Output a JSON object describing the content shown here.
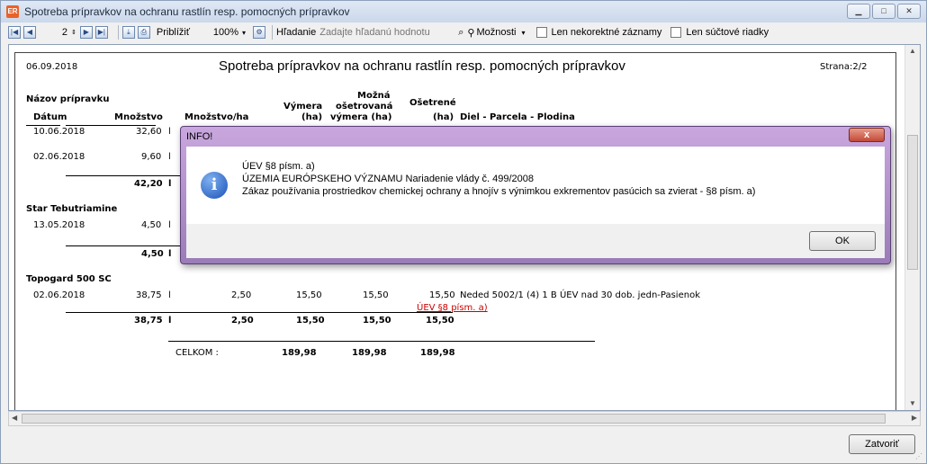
{
  "window": {
    "title": "Spotreba prípravkov na ochranu rastlín resp. pomocných prípravkov"
  },
  "toolbar": {
    "page_number": "2",
    "zoom_label": "Priblížiť",
    "zoom_value": "100%",
    "search_label": "Hľadanie",
    "search_placeholder": "Zadajte hľadanú hodnotu",
    "options_label": "Možnosti",
    "incorrect_only_label": "Len nekorektné záznamy",
    "sum_rows_label": "Len súčtové riadky"
  },
  "report": {
    "date": "06.09.2018",
    "title": "Spotreba prípravkov na ochranu rastlín resp. pomocných prípravkov",
    "page_label": "Strana:2/2",
    "headers": {
      "product_name": "Názov prípravku",
      "date": "Dátum",
      "quantity": "Množstvo",
      "quantity_per_ha": "Množstvo/ha",
      "area_line1": "Výmera",
      "area_line2": "(ha)",
      "possible_line1": "Možná",
      "possible_line2": "ošetrovaná",
      "possible_line3": "výmera (ha)",
      "treated_line1": "Ošetrené",
      "treated_line2": "(ha)",
      "location": "Diel - Parcela - Plodina"
    },
    "group1": {
      "rows": [
        {
          "date": "10.06.2018",
          "quantity": "32,60",
          "unit": "l"
        },
        {
          "date": "02.06.2018",
          "quantity": "9,60",
          "unit": "l"
        }
      ],
      "total_quantity": "42,20",
      "total_unit": "l"
    },
    "group2": {
      "name": "Star Tebutriamine",
      "rows": [
        {
          "date": "13.05.2018",
          "quantity": "4,50",
          "unit": "l"
        }
      ],
      "total_quantity": "4,50",
      "total_unit": "l"
    },
    "group3": {
      "name": "Topogard 500 SC",
      "row": {
        "date": "02.06.2018",
        "quantity": "38,75",
        "unit": "l",
        "qty_per_ha": "2,50",
        "area": "15,50",
        "possible": "15,50",
        "treated": "15,50",
        "location": "Neded 5002/1 (4) 1 B ÚEV nad 30 dob. jedn-Pasienok",
        "link": "ÚEV §8 písm. a)"
      },
      "total": {
        "quantity": "38,75",
        "unit": "l",
        "qty_per_ha": "2,50",
        "area": "15,50",
        "possible": "15,50",
        "treated": "15,50"
      }
    },
    "grand_total": {
      "label": "CELKOM :",
      "area": "189,98",
      "possible": "189,98",
      "treated": "189,98"
    }
  },
  "dialog": {
    "title": "INFO!",
    "close": "x",
    "line1": "ÚEV §8 písm. a)",
    "line2": "ÚZEMIA EURÓPSKEHO VÝZNAMU Nariadenie vlády č. 499/2008",
    "line3": "Zákaz používania prostriedkov chemickej ochrany a hnojív s výnimkou exkrementov pasúcich sa zvierat - §8 písm. a)",
    "ok_label": "OK"
  },
  "footer": {
    "close_label": "Zatvoriť"
  },
  "colors": {
    "dialog_frame": "#b596d0",
    "link": "#cc0000",
    "accent": "#1a52b8"
  }
}
